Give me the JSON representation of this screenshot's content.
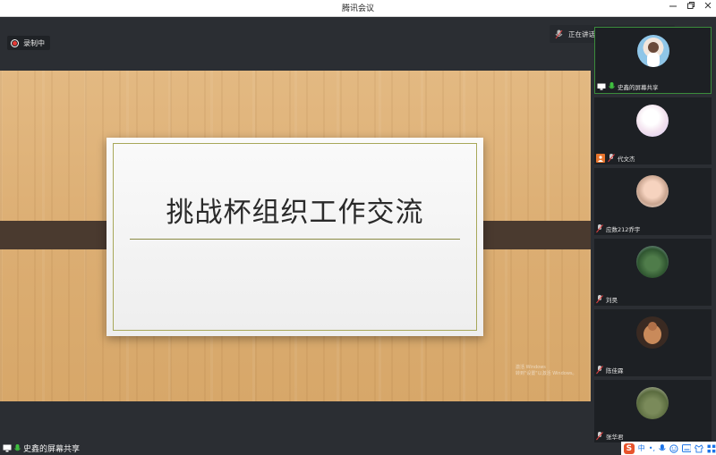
{
  "window": {
    "title": "腾讯会议"
  },
  "recording": {
    "label": "录制中"
  },
  "speaking": {
    "text": "正在讲话: 史鑫;"
  },
  "slide": {
    "title": "挑战杯组织工作交流",
    "watermark_line1": "激活 Windows",
    "watermark_line2": "转到\"设置\"以激活 Windows。"
  },
  "share": {
    "label": "史鑫的屏幕共享"
  },
  "participants": [
    {
      "name": "史鑫的屏幕共享"
    },
    {
      "name": "代文杰"
    },
    {
      "name": "应数212乔宇"
    },
    {
      "name": "刘昊"
    },
    {
      "name": "陈佳霖"
    },
    {
      "name": "张华君"
    }
  ],
  "tray": {
    "ime": "中",
    "ime_punct": "•,",
    "ime_logo": "S"
  },
  "colors": {
    "accent_green": "#3b8c3b",
    "record_red": "#e53935",
    "panel_bg": "#1d2024"
  }
}
